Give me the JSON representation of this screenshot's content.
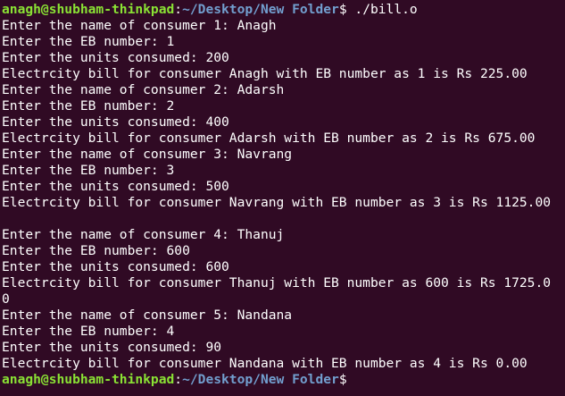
{
  "theme": {
    "background": "#300a24",
    "foreground": "#ffffff",
    "prompt_user_color": "#8ae234",
    "prompt_path_color": "#729fcf"
  },
  "prompt": {
    "user_host": "anagh@shubham-thinkpad",
    "colon": ":",
    "path": "~/Desktop/New Folder",
    "dollar": "$",
    "command": " ./bill.o"
  },
  "output": [
    "Enter the name of consumer 1: Anagh",
    "Enter the EB number: 1",
    "Enter the units consumed: 200",
    "Electrcity bill for consumer Anagh with EB number as 1 is Rs 225.00",
    "Enter the name of consumer 2: Adarsh",
    "Enter the EB number: 2",
    "Enter the units consumed: 400",
    "Electrcity bill for consumer Adarsh with EB number as 2 is Rs 675.00",
    "Enter the name of consumer 3: Navrang",
    "Enter the EB number: 3",
    "Enter the units consumed: 500",
    "Electrcity bill for consumer Navrang with EB number as 3 is Rs 1125.00",
    "",
    "Enter the name of consumer 4: Thanuj",
    "Enter the EB number: 600",
    "Enter the units consumed: 600",
    "Electrcity bill for consumer Thanuj with EB number as 600 is Rs 1725.0",
    "0",
    "Enter the name of consumer 5: Nandana",
    "Enter the EB number: 4",
    "Enter the units consumed: 90",
    "Electrcity bill for consumer Nandana with EB number as 4 is Rs 0.00"
  ]
}
